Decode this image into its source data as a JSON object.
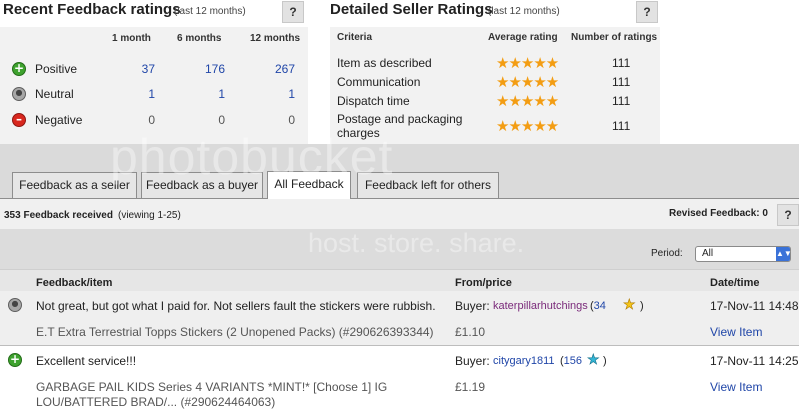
{
  "recent": {
    "title": "Recent Feedback ratings",
    "note": "(last 12 months)",
    "help": "?",
    "headers": [
      "1 month",
      "6 months",
      "12 months"
    ],
    "rows": [
      {
        "label": "Positive",
        "icon": "positive-icon",
        "values": [
          "37",
          "176",
          "267"
        ]
      },
      {
        "label": "Neutral",
        "icon": "neutral-icon",
        "values": [
          "1",
          "1",
          "1"
        ]
      },
      {
        "label": "Negative",
        "icon": "negative-icon",
        "values": [
          "0",
          "0",
          "0"
        ]
      }
    ]
  },
  "dsr": {
    "title": "Detailed Seller Ratings",
    "note": "(last 12 months)",
    "help": "?",
    "headers": {
      "criteria": "Criteria",
      "avg": "Average rating",
      "count": "Number of ratings"
    },
    "rows": [
      {
        "label": "Item as described",
        "rating": 5,
        "count": "111"
      },
      {
        "label": "Communication",
        "rating": 5,
        "count": "111"
      },
      {
        "label": "Dispatch time",
        "rating": 5,
        "count": "111"
      },
      {
        "label": "Postage and packaging",
        "label2": "charges",
        "rating": 5,
        "count": "111"
      }
    ]
  },
  "tabs": [
    "Feedback as a seller",
    "Feedback as a buyer",
    "All Feedback",
    "Feedback left for others"
  ],
  "active_tab": "All Feedback",
  "summary": {
    "received": "353 Feedback received",
    "viewing": "(viewing 1-25)",
    "revised": "Revised Feedback: 0",
    "help": "?"
  },
  "period": {
    "label": "Period:",
    "value": "All"
  },
  "table": {
    "headers": {
      "item": "Feedback/item",
      "from": "From/price",
      "date": "Date/time"
    },
    "rows": [
      {
        "icon": "neutral-icon",
        "comment": "Not great, but got what I paid for. Not sellers fault the stickers were rubbish.",
        "buyer_label": "Buyer:",
        "buyer": "katerpillarhutchings",
        "score": "34",
        "star_color": "#f5c518",
        "date": "17-Nov-11 14:48",
        "item": "E.T Extra Terrestrial Topps Stickers (2 Unopened Packs) (#290626393344)",
        "price": "£1.10",
        "view": "View Item"
      },
      {
        "icon": "positive-icon",
        "comment": "Excellent service!!!",
        "buyer_label": "Buyer:",
        "buyer": "citygary1811",
        "score": "156",
        "star_color": "#33b6d6",
        "date": "17-Nov-11 14:25",
        "item": "GARBAGE PAIL KIDS Series 4 VARIANTS *MINT!* [Choose 1] IG",
        "item2": "LOU/BATTERED BRAD/... (#290624464063)",
        "price": "£1.19",
        "view": "View Item"
      }
    ]
  },
  "watermark": {
    "line1": "photobucket",
    "line2": "host. store. share."
  }
}
